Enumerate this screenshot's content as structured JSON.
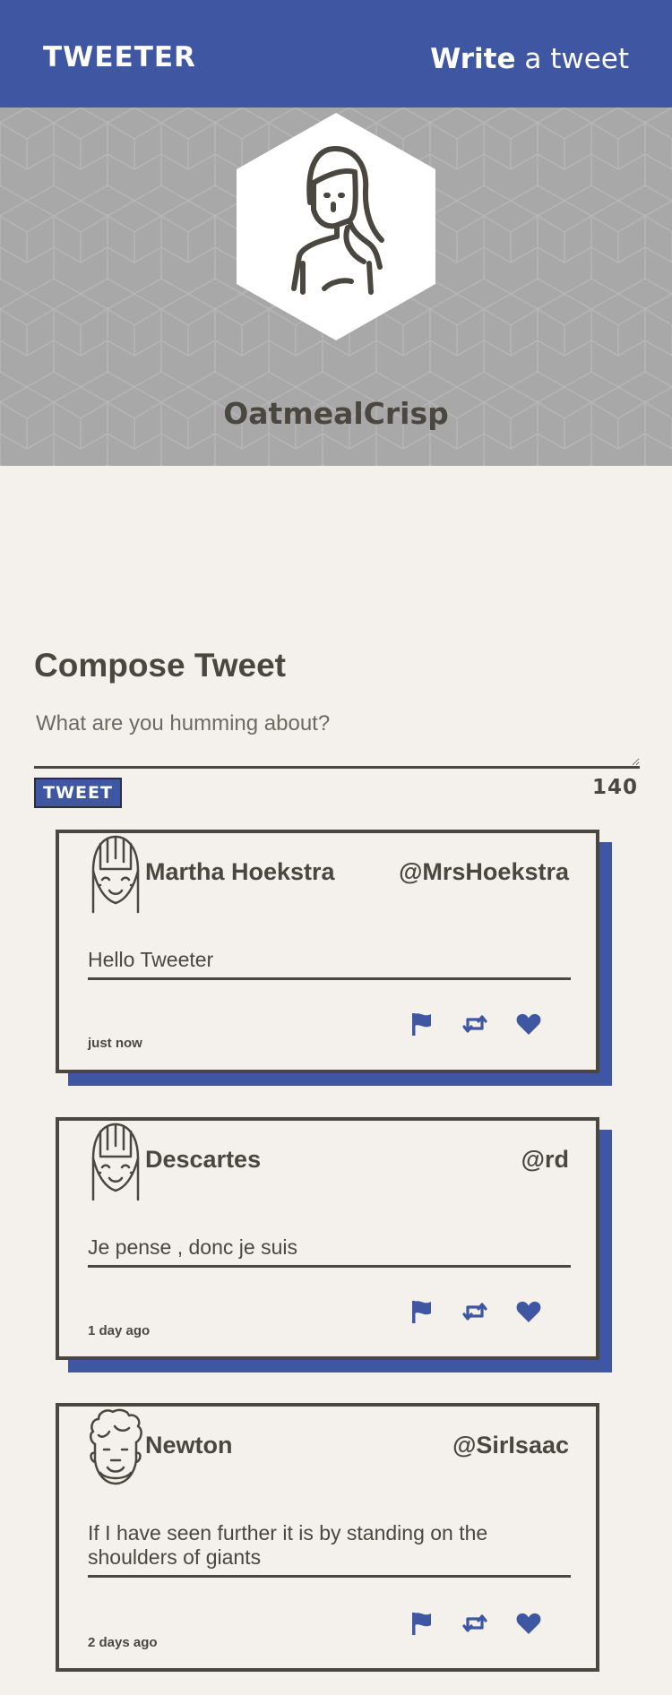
{
  "nav": {
    "brand": "TWEETER",
    "write_bold": "Write",
    "write_rest": " a tweet"
  },
  "profile": {
    "username": "OatmealCrisp",
    "avatar_icon": "woman-avatar-icon"
  },
  "compose": {
    "title": "Compose Tweet",
    "placeholder": "What are you humming about?",
    "value": "",
    "button_label": "TWEET",
    "counter": "140"
  },
  "tweets": [
    {
      "name": "Martha Hoekstra",
      "handle": "@MrsHoekstra",
      "content": "Hello Tweeter",
      "time": "just now",
      "avatar_icon": "smiling-face-avatar-icon"
    },
    {
      "name": "Descartes",
      "handle": "@rd",
      "content": "Je pense , donc je suis",
      "time": "1 day ago",
      "avatar_icon": "smiling-face-avatar-icon"
    },
    {
      "name": "Newton",
      "handle": "@SirIsaac",
      "content": "If I have seen further it is by standing on the shoulders of giants",
      "time": "2 days ago",
      "avatar_icon": "curly-hair-avatar-icon"
    }
  ],
  "colors": {
    "accent": "#3f56a2",
    "text": "#4a4740",
    "background": "#f4f1ec",
    "profile_bg": "#a8a8a8"
  }
}
